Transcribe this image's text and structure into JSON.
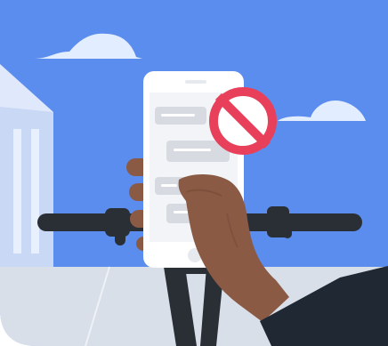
{
  "illustration": {
    "colors": {
      "sky": "#5b8def",
      "cloud": "#eaf2ff",
      "building_light": "#dfe9fb",
      "building_mid": "#c9d8f5",
      "ground": "#d9dfe8",
      "road_line": "#eef2f7",
      "handlebar": "#2a2f36",
      "phone_body": "#ffffff",
      "phone_screen": "#f2f4f7",
      "bubble_gray": "#d7dbe1",
      "bubble_line": "#ffffff",
      "prohibited_red": "#e8405b",
      "hand": "#8a5a44",
      "hand_shadow": "#744837",
      "sleeve": "#1f2833"
    },
    "icons": [
      "prohibited-icon",
      "smartphone-icon",
      "chat-bubble-icon",
      "scooter-handlebar-icon",
      "hand-icon",
      "cloud-icon",
      "building-icon"
    ]
  }
}
